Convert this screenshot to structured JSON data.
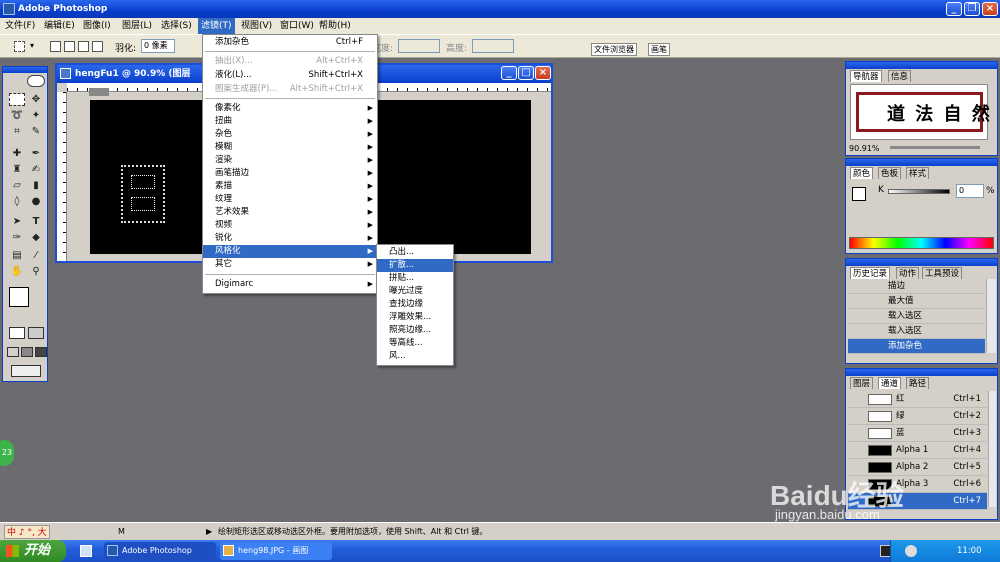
{
  "app": {
    "title": "Adobe Photoshop"
  },
  "menubar": {
    "items": [
      "文件(F)",
      "编辑(E)",
      "图像(I)",
      "图层(L)",
      "选择(S)",
      "滤镜(T)",
      "视图(V)",
      "窗口(W)",
      "帮助(H)"
    ]
  },
  "options": {
    "feather_label": "羽化:",
    "feather_value": "0 像素",
    "width_label": "宽度:",
    "height_label": "高度:",
    "tab_file_browser": "文件浏览器",
    "tab_brushes": "画笔"
  },
  "image_window": {
    "title": "hengFu1 @ 90.9% (图层"
  },
  "filter_menu": {
    "items": [
      {
        "label": "添加杂色",
        "shortcut": "Ctrl+F",
        "disabled": false
      },
      {
        "label": "抽出(X)...",
        "shortcut": "Alt+Ctrl+X",
        "disabled": true
      },
      {
        "label": "液化(L)...",
        "shortcut": "Shift+Ctrl+X",
        "disabled": false
      },
      {
        "label": "图案生成器(P)...",
        "shortcut": "Alt+Shift+Ctrl+X",
        "disabled": true
      },
      {
        "label": "像素化"
      },
      {
        "label": "扭曲"
      },
      {
        "label": "杂色"
      },
      {
        "label": "模糊"
      },
      {
        "label": "渲染"
      },
      {
        "label": "画笔描边"
      },
      {
        "label": "素描"
      },
      {
        "label": "纹理"
      },
      {
        "label": "艺术效果"
      },
      {
        "label": "视频"
      },
      {
        "label": "锐化"
      },
      {
        "label": "风格化"
      },
      {
        "label": "其它"
      },
      {
        "label": "Digimarc"
      }
    ]
  },
  "stylize_menu": {
    "items": [
      "凸出...",
      "扩散...",
      "拼贴...",
      "曝光过度",
      "查找边缘",
      "浮雕效果...",
      "照亮边缘...",
      "等高线...",
      "风..."
    ]
  },
  "navigator": {
    "tabs": [
      "导航器",
      "信息"
    ],
    "zoom": "90.91%",
    "preview_text": "道 法 自 然"
  },
  "color_panel": {
    "tabs": [
      "颜色",
      "色板",
      "样式"
    ],
    "k_label": "K",
    "k_value": "0",
    "k_unit": "%"
  },
  "history_panel": {
    "tabs": [
      "历史记录",
      "动作",
      "工具预设"
    ],
    "items": [
      "描边",
      "最大值",
      "载入选区",
      "载入选区",
      "添加杂色"
    ],
    "selected_index": 4
  },
  "channels_panel": {
    "tabs": [
      "图层",
      "通道",
      "路径"
    ],
    "items": [
      {
        "name": "红",
        "shortcut": "Ctrl+1"
      },
      {
        "name": "绿",
        "shortcut": "Ctrl+2"
      },
      {
        "name": "蓝",
        "shortcut": "Ctrl+3"
      },
      {
        "name": "Alpha 1",
        "shortcut": "Ctrl+4"
      },
      {
        "name": "Alpha 2",
        "shortcut": "Ctrl+5"
      },
      {
        "name": "Alpha 3",
        "shortcut": "Ctrl+6"
      },
      {
        "name": "",
        "shortcut": "Ctrl+7"
      }
    ]
  },
  "statusbar": {
    "ime_text": "中 ♪ °, 大",
    "zoom": "M",
    "hint": "绘制矩形选区或移动选区外框。要用附加选项，使用 Shift、Alt 和 Ctrl 键。"
  },
  "taskbar": {
    "start": "开始",
    "tasks": [
      "Adobe Photoshop",
      "heng98.JPG - 画图"
    ],
    "clock": "11:00"
  },
  "watermark": {
    "brand": "Baidu经验",
    "url": "jingyan.baidu.com"
  },
  "badge": "23",
  "colors": {
    "xp_blue": "#0a3fcc",
    "highlight": "#316ac5",
    "desktop": "#6b6b70"
  }
}
